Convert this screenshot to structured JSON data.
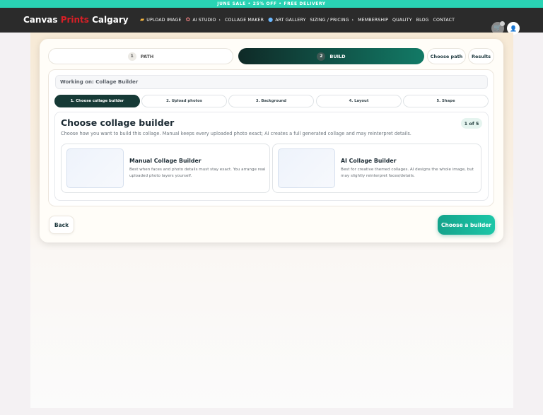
{
  "promo": {
    "text": "JUNE SALE • 25% OFF • FREE DELIVERY"
  },
  "header": {
    "logo": {
      "part1": "Canvas ",
      "part2": "Prints",
      "part3": " Calgary"
    },
    "nav": [
      {
        "label": "UPLOAD IMAGE",
        "icon": "folder-icon",
        "chevron": false
      },
      {
        "label": "AI STUDIO",
        "icon": "palette-icon",
        "chevron": true
      },
      {
        "label": "COLLAGE MAKER",
        "icon": "",
        "chevron": false
      },
      {
        "label": "ART GALLERY",
        "icon": "search-icon",
        "chevron": false
      },
      {
        "label": "SIZING / PRICING",
        "icon": "",
        "chevron": true
      },
      {
        "label": "MEMBERSHIP",
        "icon": "",
        "chevron": false
      },
      {
        "label": "QUALITY",
        "icon": "",
        "chevron": false
      },
      {
        "label": "BLOG",
        "icon": "",
        "chevron": false
      },
      {
        "label": "CONTACT",
        "icon": "",
        "chevron": false
      }
    ]
  },
  "steps": {
    "path": {
      "num": "1",
      "label": "PATH"
    },
    "build": {
      "num": "2",
      "label": "BUILD"
    },
    "choose_path": "Choose path",
    "results": "Results"
  },
  "working": {
    "text": "Working on: Collage Builder"
  },
  "subtabs": [
    "1. Choose collage builder",
    "2. Upload photos",
    "3. Background",
    "4. Layout",
    "5. Shape"
  ],
  "builder": {
    "title": "Choose collage builder",
    "description": "Choose how you want to build this collage. Manual keeps every uploaded photo exact; AI creates a full generated collage and may reinterpret details.",
    "count": "1 of 5",
    "options": [
      {
        "title": "Manual Collage Builder",
        "description": "Best when faces and photo details must stay exact. You arrange real uploaded photo layers yourself."
      },
      {
        "title": "AI Collage Builder",
        "description": "Best for creative themed collages. AI designs the whole image, but may slightly reinterpret faces/details."
      }
    ]
  },
  "footer": {
    "back": "Back",
    "choose": "Choose a builder"
  },
  "colors": {
    "accent": "#1cc7a8",
    "dark_green": "#163a36",
    "nav_bg": "#2b2b2b",
    "promo": "#29d3b4"
  }
}
